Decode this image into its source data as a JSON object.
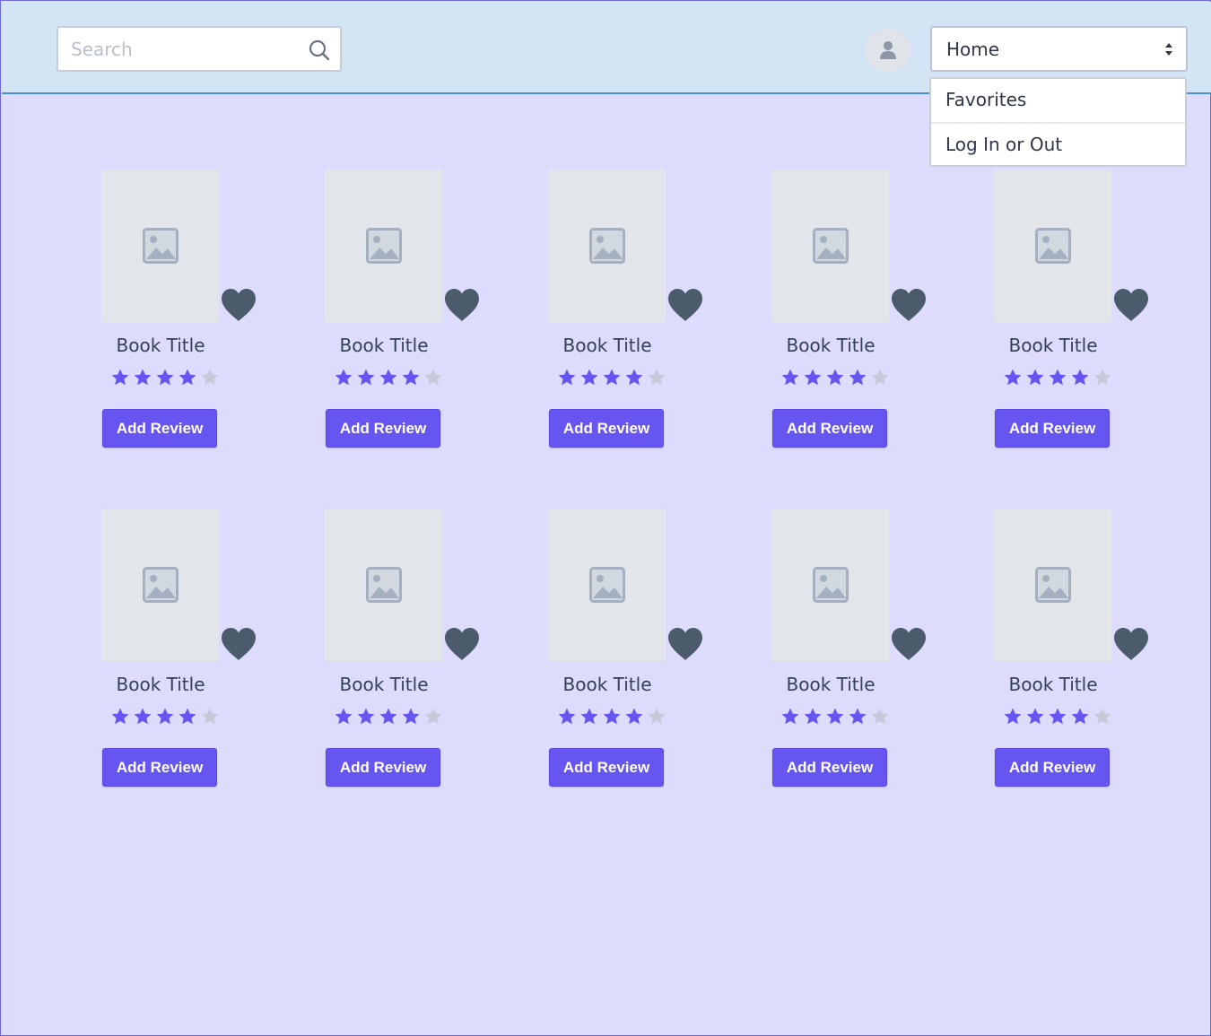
{
  "search": {
    "placeholder": "Search"
  },
  "nav_select": {
    "value": "Home",
    "options": [
      "Favorites",
      "Log In or Out"
    ]
  },
  "colors": {
    "header_bg": "#d3e4f5",
    "page_bg": "#dedcfc",
    "accent": "#6655f0",
    "star_filled": "#6655f0",
    "star_empty": "#c6c9d8",
    "heart": "#4b5b6b"
  },
  "books": [
    {
      "title": "Book Title",
      "rating": 4,
      "max_rating": 5,
      "button": "Add Review"
    },
    {
      "title": "Book Title",
      "rating": 4,
      "max_rating": 5,
      "button": "Add Review"
    },
    {
      "title": "Book Title",
      "rating": 4,
      "max_rating": 5,
      "button": "Add Review"
    },
    {
      "title": "Book Title",
      "rating": 4,
      "max_rating": 5,
      "button": "Add Review"
    },
    {
      "title": "Book Title",
      "rating": 4,
      "max_rating": 5,
      "button": "Add Review"
    },
    {
      "title": "Book Title",
      "rating": 4,
      "max_rating": 5,
      "button": "Add Review"
    },
    {
      "title": "Book Title",
      "rating": 4,
      "max_rating": 5,
      "button": "Add Review"
    },
    {
      "title": "Book Title",
      "rating": 4,
      "max_rating": 5,
      "button": "Add Review"
    },
    {
      "title": "Book Title",
      "rating": 4,
      "max_rating": 5,
      "button": "Add Review"
    },
    {
      "title": "Book Title",
      "rating": 4,
      "max_rating": 5,
      "button": "Add Review"
    }
  ]
}
